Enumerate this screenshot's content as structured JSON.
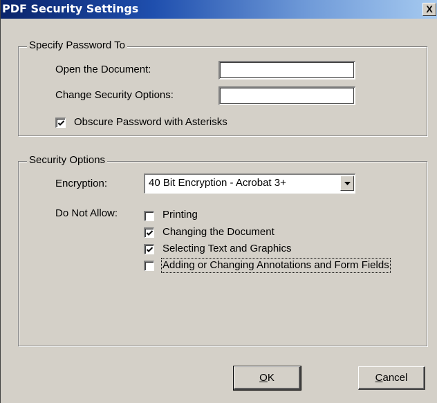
{
  "window": {
    "title": "PDF Security Settings",
    "close_glyph": "X"
  },
  "password_group": {
    "legend": "Specify Password To",
    "open_label": "Open the Document:",
    "open_value": "",
    "change_label": "Change Security Options:",
    "change_value": "",
    "obscure_label": "Obscure Password with Asterisks",
    "obscure_checked": true
  },
  "security_group": {
    "legend": "Security Options",
    "encryption_label": "Encryption:",
    "encryption_value": "40 Bit Encryption - Acrobat 3+",
    "do_not_allow_label": "Do Not Allow:",
    "options": [
      {
        "label": "Printing",
        "checked": false
      },
      {
        "label": "Changing the Document",
        "checked": true
      },
      {
        "label": "Selecting Text and Graphics",
        "checked": true
      },
      {
        "label": "Adding or Changing Annotations and Form Fields",
        "checked": false
      }
    ]
  },
  "buttons": {
    "ok_label": "OK",
    "cancel_label": "Cancel"
  },
  "icons": {
    "close": "close-icon",
    "dropdown": "chevron-down-icon",
    "check": "checkmark-icon"
  }
}
